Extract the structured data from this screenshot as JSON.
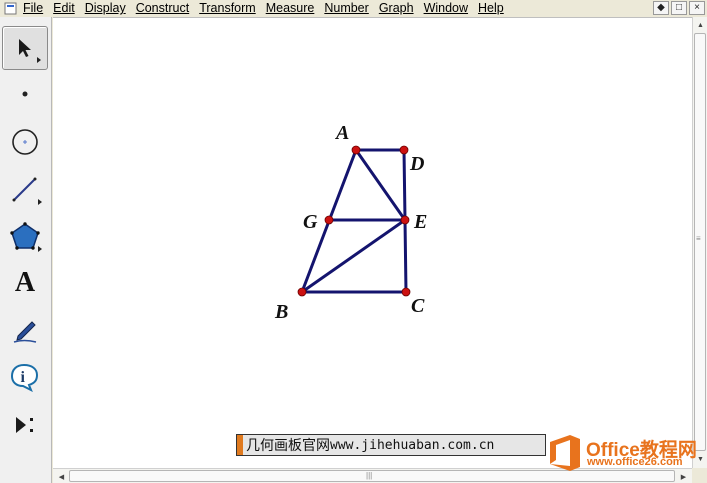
{
  "menu": {
    "items": [
      {
        "label": "File"
      },
      {
        "label": "Edit"
      },
      {
        "label": "Display"
      },
      {
        "label": "Construct"
      },
      {
        "label": "Transform"
      },
      {
        "label": "Measure"
      },
      {
        "label": "Number"
      },
      {
        "label": "Graph"
      },
      {
        "label": "Window"
      },
      {
        "label": "Help"
      }
    ],
    "window_buttons": [
      "◆",
      "□",
      "×"
    ]
  },
  "toolbox": {
    "tools": [
      {
        "name": "arrow-tool",
        "icon": "arrow-select-icon",
        "selected": true
      },
      {
        "name": "point-tool",
        "icon": "point-icon"
      },
      {
        "name": "compass-tool",
        "icon": "compass-circle-icon"
      },
      {
        "name": "straightedge-tool",
        "icon": "line-segment-icon"
      },
      {
        "name": "polygon-tool",
        "icon": "pentagon-icon"
      },
      {
        "name": "text-tool",
        "icon": "text-A-icon",
        "glyph": "A"
      },
      {
        "name": "marker-tool",
        "icon": "pen-icon"
      },
      {
        "name": "information-tool",
        "icon": "info-icon",
        "glyph": "i"
      },
      {
        "name": "custom-tool",
        "icon": "custom-tool-icon"
      }
    ]
  },
  "figure": {
    "line_color": "#14146e",
    "point_color": "#cc1111",
    "points": [
      {
        "label": "A"
      },
      {
        "label": "D"
      },
      {
        "label": "G"
      },
      {
        "label": "E"
      },
      {
        "label": "B"
      },
      {
        "label": "C"
      }
    ],
    "segments": [
      [
        "A",
        "D"
      ],
      [
        "D",
        "E"
      ],
      [
        "E",
        "C"
      ],
      [
        "C",
        "B"
      ],
      [
        "B",
        "A"
      ],
      [
        "A",
        "E"
      ],
      [
        "G",
        "E"
      ],
      [
        "B",
        "E"
      ]
    ]
  },
  "caption": {
    "text_cn": "几何画板官网",
    "text_url": "www.jihehuaban.com.cn"
  },
  "logo": {
    "title": "Office教程网",
    "url": "www.office26.com",
    "accent": "#e8731d"
  },
  "scroll": {
    "grip": "≡",
    "hgrip": "|||"
  }
}
